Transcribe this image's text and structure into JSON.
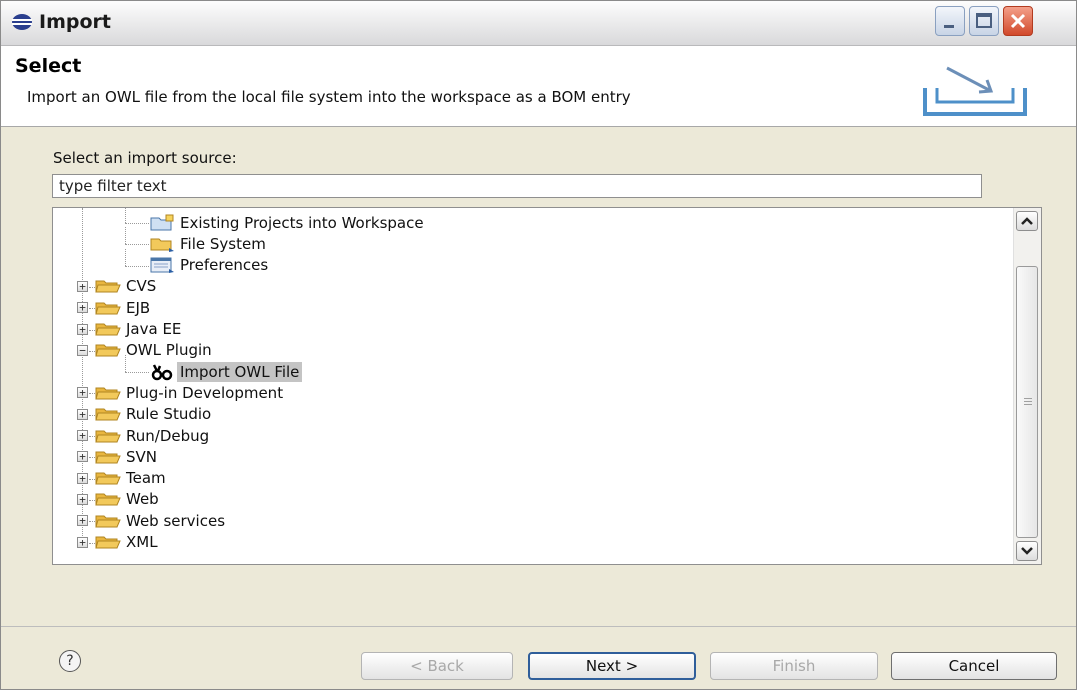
{
  "window": {
    "title": "Import"
  },
  "banner": {
    "title": "Select",
    "description": "Import an OWL file from the local file system into the workspace as a BOM entry"
  },
  "source": {
    "label": "Select an import source:",
    "filter_value": "type filter text"
  },
  "tree": {
    "items": [
      {
        "label": "Existing Projects into Workspace",
        "icon": "project-import-icon",
        "level": 1,
        "expander": "none"
      },
      {
        "label": "File System",
        "icon": "folder-import-icon",
        "level": 1,
        "expander": "none"
      },
      {
        "label": "Preferences",
        "icon": "preferences-import-icon",
        "level": 1,
        "expander": "none"
      },
      {
        "label": "CVS",
        "icon": "folder-icon",
        "level": 0,
        "expander": "collapsed"
      },
      {
        "label": "EJB",
        "icon": "folder-icon",
        "level": 0,
        "expander": "collapsed"
      },
      {
        "label": "Java EE",
        "icon": "folder-icon",
        "level": 0,
        "expander": "collapsed"
      },
      {
        "label": "OWL Plugin",
        "icon": "folder-icon",
        "level": 0,
        "expander": "expanded"
      },
      {
        "label": "Import OWL File",
        "icon": "owl-import-icon",
        "level": 1,
        "expander": "none",
        "selected": true
      },
      {
        "label": "Plug-in Development",
        "icon": "folder-icon",
        "level": 0,
        "expander": "collapsed"
      },
      {
        "label": "Rule Studio",
        "icon": "folder-icon",
        "level": 0,
        "expander": "collapsed"
      },
      {
        "label": "Run/Debug",
        "icon": "folder-icon",
        "level": 0,
        "expander": "collapsed"
      },
      {
        "label": "SVN",
        "icon": "folder-icon",
        "level": 0,
        "expander": "collapsed"
      },
      {
        "label": "Team",
        "icon": "folder-icon",
        "level": 0,
        "expander": "collapsed"
      },
      {
        "label": "Web",
        "icon": "folder-icon",
        "level": 0,
        "expander": "collapsed"
      },
      {
        "label": "Web services",
        "icon": "folder-icon",
        "level": 0,
        "expander": "collapsed"
      },
      {
        "label": "XML",
        "icon": "folder-icon",
        "level": 0,
        "expander": "collapsed"
      }
    ]
  },
  "footer": {
    "help_glyph": "?",
    "back_label": "< Back",
    "next_label": "Next >",
    "finish_label": "Finish",
    "cancel_label": "Cancel"
  },
  "colors": {
    "selection": "#c4c4c4",
    "folder": "#f2c95b",
    "default_button_border": "#2f5e9a"
  }
}
